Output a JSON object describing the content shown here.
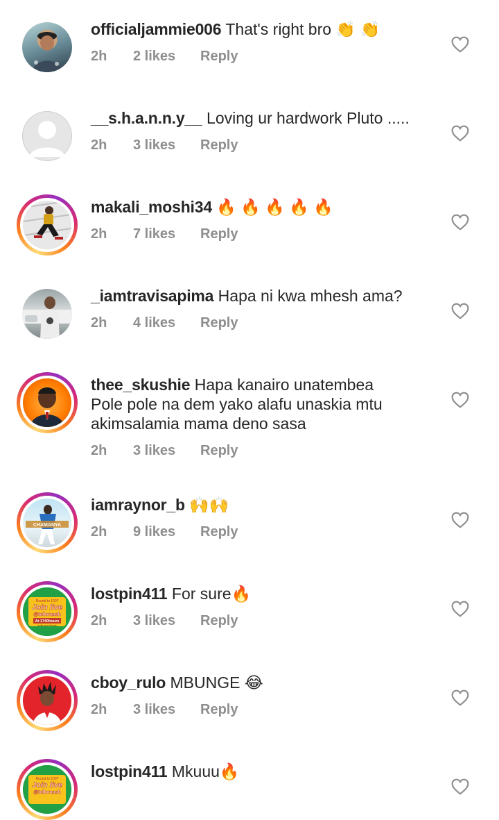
{
  "comments": [
    {
      "username": "officialjammie006",
      "text": "That's right bro 👏 👏",
      "time": "2h",
      "likes": "2 likes",
      "reply": "Reply"
    },
    {
      "username": "__s.h.a.n.n.y__",
      "text": "Loving ur hardwork Pluto .....",
      "time": "2h",
      "likes": "3 likes",
      "reply": "Reply"
    },
    {
      "username": "makali_moshi34",
      "text": "🔥 🔥 🔥 🔥 🔥",
      "time": "2h",
      "likes": "7 likes",
      "reply": "Reply"
    },
    {
      "username": "_iamtravisapima",
      "text": "Hapa ni kwa mhesh ama?",
      "time": "2h",
      "likes": "4 likes",
      "reply": "Reply"
    },
    {
      "username": "thee_skushie",
      "text": "Hapa kanairo unatembea",
      "text2": "Pole pole na dem yako alafu unaskia mtu",
      "text3": "akimsalamia mama deno sasa",
      "time": "2h",
      "likes": "3 likes",
      "reply": "Reply"
    },
    {
      "username": "iamraynor_b",
      "text": "🙌🙌",
      "time": "2h",
      "likes": "9 likes",
      "reply": "Reply"
    },
    {
      "username": "lostpin411",
      "text": "For sure🔥",
      "time": "2h",
      "likes": "3 likes",
      "reply": "Reply"
    },
    {
      "username": "cboy_rulo",
      "text": "MBUNGE 😂",
      "time": "2h",
      "likes": "3 likes",
      "reply": "Reply"
    },
    {
      "username": "lostpin411",
      "text": "Mkuuu🔥"
    }
  ],
  "avatar_texts": {
    "raynor": "CHAMANYA",
    "lostpin_small": "Round to 100?",
    "lostpin_main": "Join live",
    "lostpin_handle": "@tellomash",
    "lostpin_time": "At 1740hours",
    "lostpin_sub": "invite your friends"
  },
  "colors": {
    "username": "#262626",
    "meta": "#8e8e8e",
    "heart": "#8e8e8e",
    "story_ring": "#d62976"
  },
  "icons": {
    "like": "heart-outline-icon"
  }
}
